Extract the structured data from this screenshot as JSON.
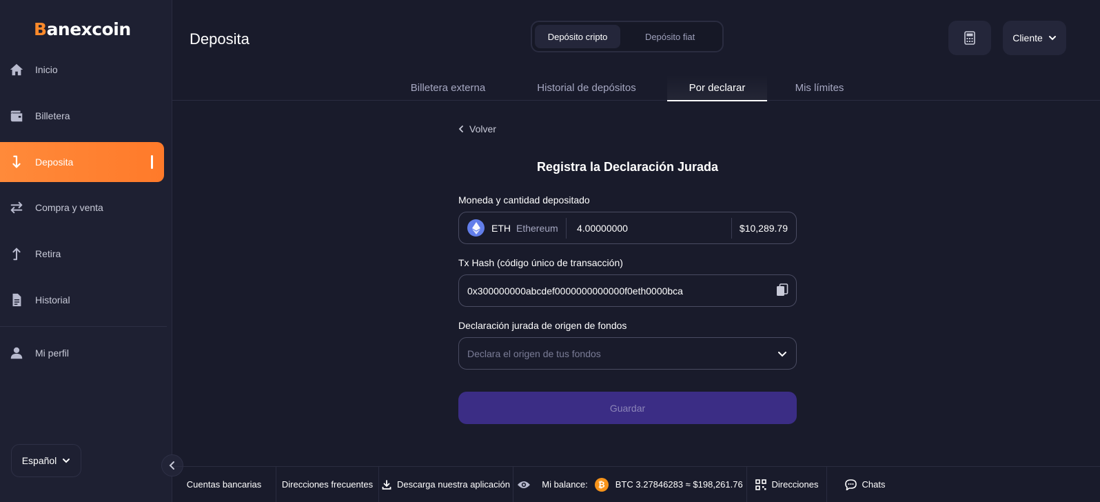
{
  "brand": {
    "logo_prefix": "B",
    "logo_rest": "anexcoin",
    "accent": "#ff8a2a"
  },
  "sidebar": {
    "items": [
      {
        "label": "Inicio",
        "icon": "home-icon"
      },
      {
        "label": "Billetera",
        "icon": "wallet-icon"
      },
      {
        "label": "Deposita",
        "icon": "deposit-icon",
        "active": true
      },
      {
        "label": "Compra y venta",
        "icon": "swap-icon"
      },
      {
        "label": "Retira",
        "icon": "withdraw-icon"
      },
      {
        "label": "Historial",
        "icon": "document-icon"
      }
    ],
    "profile": {
      "label": "Mi perfil",
      "icon": "user-icon"
    },
    "language": "Español"
  },
  "header": {
    "title": "Deposita",
    "segment": {
      "crypto": "Depósito cripto",
      "fiat": "Depósito fiat"
    },
    "client_label": "Cliente"
  },
  "tabs": [
    {
      "label": "Billetera externa"
    },
    {
      "label": "Historial de depósitos"
    },
    {
      "label": "Por declarar",
      "active": true
    },
    {
      "label": "Mis límites"
    }
  ],
  "form": {
    "back_label": "Volver",
    "title": "Registra la Declaración Jurada",
    "currency_label": "Moneda y cantidad depositado",
    "coin_symbol": "ETH",
    "coin_name": "Ethereum",
    "amount": "4.00000000",
    "usd_value": "$10,289.79",
    "hash_label": "Tx Hash (código único de transacción)",
    "hash_value": "0x300000000abcdef0000000000000f0eth0000bca",
    "origin_label": "Declaración jurada de origen de fondos",
    "origin_placeholder": "Declara el origen de tus fondos",
    "save_label": "Guardar"
  },
  "footer": {
    "bank_accounts": "Cuentas bancarias",
    "frequent_addresses": "Direcciones frecuentes",
    "download_app": "Descarga nuestra aplicación",
    "balance_label": "Mi balance:",
    "balance_value": "BTC 3.27846283 ≈ $198,261.76",
    "addresses": "Direcciones",
    "chats": "Chats"
  }
}
